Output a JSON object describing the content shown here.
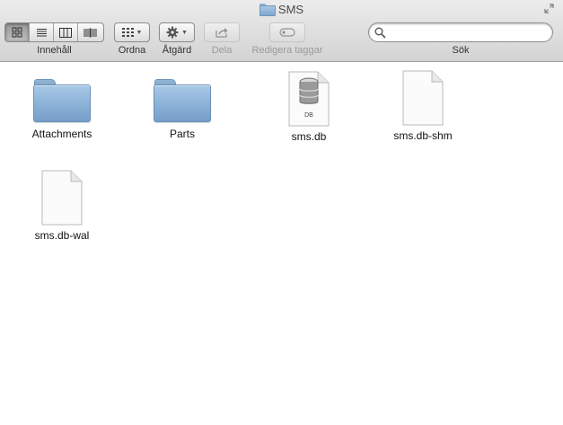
{
  "window": {
    "title": "SMS"
  },
  "toolbar": {
    "view_label": "Innehåll",
    "arrange_label": "Ordna",
    "action_label": "Åtgärd",
    "share_label": "Dela",
    "tags_label": "Redigera taggar",
    "search_label": "Sök",
    "search_value": "",
    "search_placeholder": ""
  },
  "files": [
    {
      "name": "Attachments",
      "kind": "folder-icon"
    },
    {
      "name": "Parts",
      "kind": "folder-icon"
    },
    {
      "name": "sms.db",
      "kind": "database-document-icon",
      "badge": "DB"
    },
    {
      "name": "sms.db-shm",
      "kind": "blank-document-icon"
    },
    {
      "name": "sms.db-wal",
      "kind": "blank-document-icon"
    }
  ],
  "colors": {
    "folder": "#8fb5da",
    "toolbar": "#d3d3d3"
  }
}
